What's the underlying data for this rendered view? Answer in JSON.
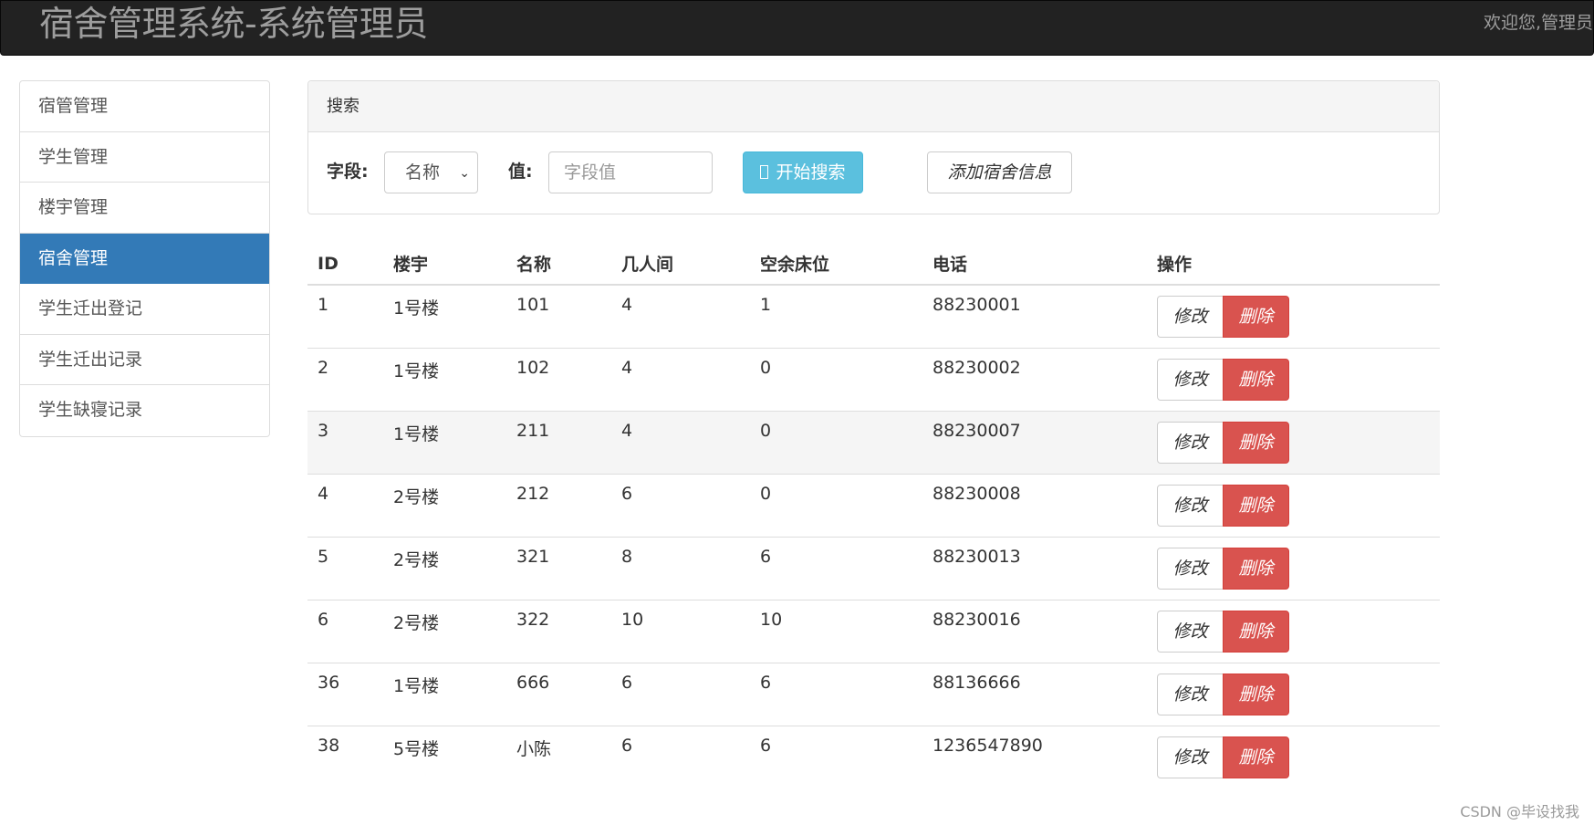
{
  "header": {
    "title": "宿舍管理系统-系统管理员",
    "welcome": "欢迎您,管理员"
  },
  "sidebar": {
    "items": [
      {
        "label": "宿管管理"
      },
      {
        "label": "学生管理"
      },
      {
        "label": "楼宇管理"
      },
      {
        "label": "宿舍管理",
        "active": true
      },
      {
        "label": "学生迁出登记"
      },
      {
        "label": "学生迁出记录"
      },
      {
        "label": "学生缺寝记录"
      }
    ]
  },
  "search": {
    "heading": "搜索",
    "field_label": "字段:",
    "field_value": "名称",
    "value_label": "值:",
    "value_placeholder": "字段值",
    "search_button": "开始搜索",
    "add_button": "添加宿舍信息"
  },
  "table": {
    "headers": [
      "ID",
      "楼宇",
      "名称",
      "几人间",
      "空余床位",
      "电话",
      "操作"
    ],
    "rows": [
      [
        "1",
        "1号楼",
        "101",
        "4",
        "1",
        "88230001"
      ],
      [
        "2",
        "1号楼",
        "102",
        "4",
        "0",
        "88230002"
      ],
      [
        "3",
        "1号楼",
        "211",
        "4",
        "0",
        "88230007"
      ],
      [
        "4",
        "2号楼",
        "212",
        "6",
        "0",
        "88230008"
      ],
      [
        "5",
        "2号楼",
        "321",
        "8",
        "6",
        "88230013"
      ],
      [
        "6",
        "2号楼",
        "322",
        "10",
        "10",
        "88230016"
      ],
      [
        "36",
        "1号楼",
        "666",
        "6",
        "6",
        "88136666"
      ],
      [
        "38",
        "5号楼",
        "小陈",
        "6",
        "6",
        "1236547890"
      ]
    ],
    "edit_label": "修改",
    "delete_label": "删除"
  },
  "watermark": "CSDN @毕设找我",
  "colors": {
    "navbar": "#222222",
    "active": "#337ab7",
    "info": "#5bc0de",
    "danger": "#d9534f"
  }
}
